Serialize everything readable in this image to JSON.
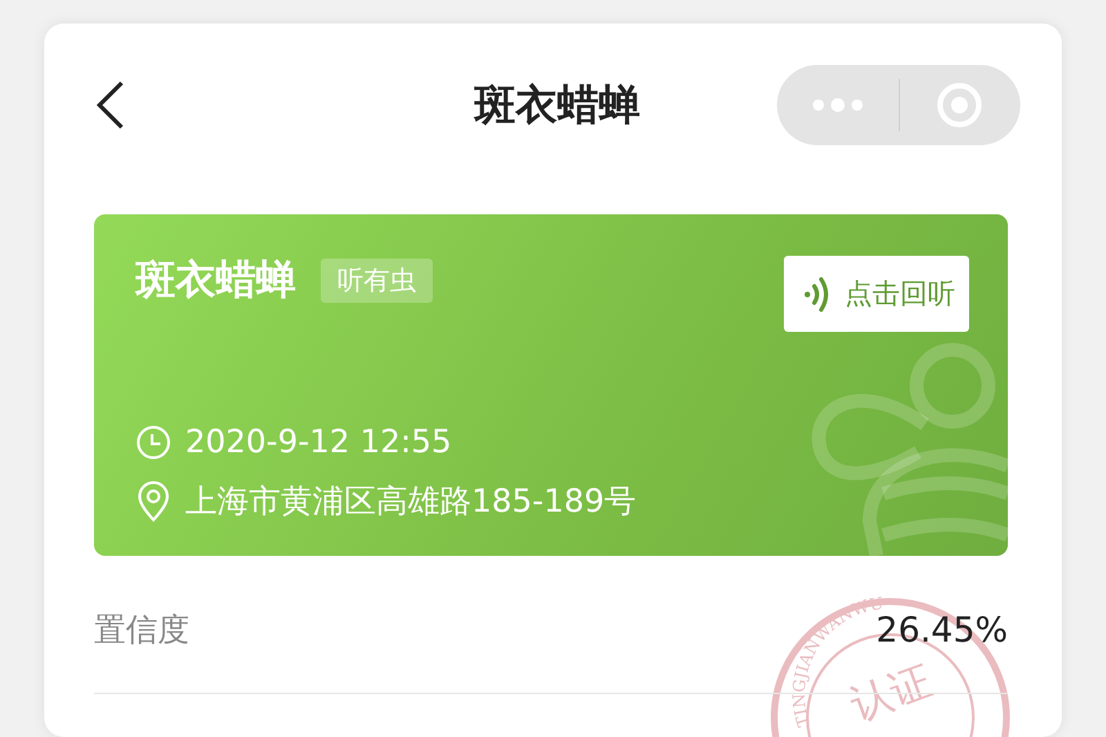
{
  "header": {
    "title": "斑衣蜡蝉"
  },
  "card": {
    "name": "斑衣蜡蝉",
    "tag": "听有虫",
    "replay_button": "点击回听",
    "time": "2020-9-12  12:55",
    "location": "上海市黄浦区高雄路185-189号"
  },
  "details": [
    {
      "label": "置信度",
      "value": "26.45%"
    }
  ],
  "stamp": {
    "ring_text": "TINGJIANWANWU",
    "center_text": "认证"
  }
}
